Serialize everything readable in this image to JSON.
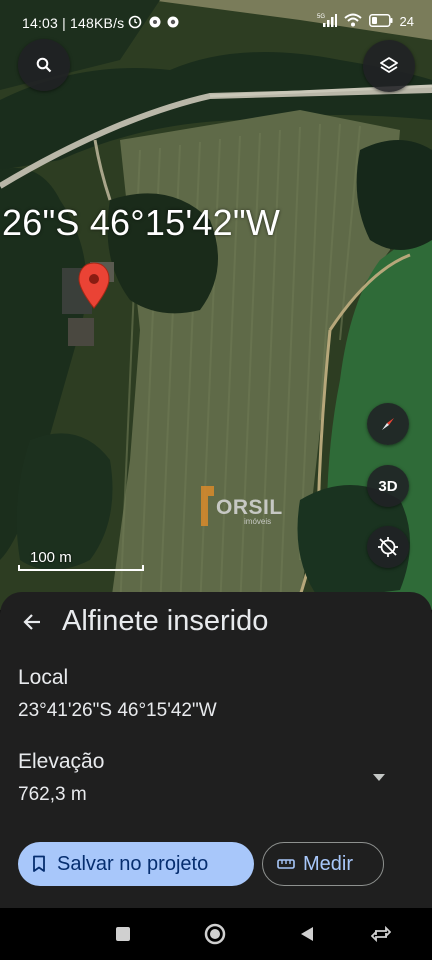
{
  "status_bar": {
    "time": "14:03",
    "network_speed": "148KB/s",
    "time_and_speed": "14:03 | 148KB/s",
    "signal_label": "5G",
    "battery": "24"
  },
  "map": {
    "coordinates_overlay": "26\"S 46°15'42\"W",
    "scale_label": "100 m",
    "watermark_text": "ORSIL",
    "watermark_subtext": "imóveis",
    "btn_3d_label": "3D",
    "icons": {
      "search": "search-icon",
      "layers": "layers-icon",
      "compass": "compass-icon",
      "gps": "gps-off-icon",
      "pin": "map-pin-icon"
    }
  },
  "sheet": {
    "title": "Alfinete inserido",
    "local_label": "Local",
    "local_value": "23°41'26\"S 46°15'42\"W",
    "elevation_label": "Elevação",
    "elevation_value": "762,3 m",
    "save_button": "Salvar no projeto",
    "measure_button": "Medir"
  },
  "colors": {
    "sheet_background": "#1f1f1f",
    "primary_button": "#a8c7fa",
    "primary_button_text": "#062e6f",
    "pin": "#ea4335"
  }
}
